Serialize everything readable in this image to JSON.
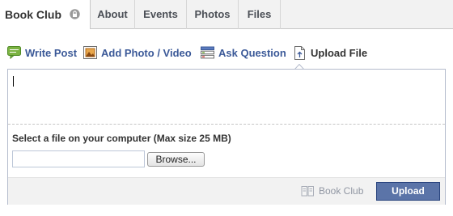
{
  "group": {
    "name": "Book Club"
  },
  "tabs": [
    {
      "label": "About"
    },
    {
      "label": "Events"
    },
    {
      "label": "Photos"
    },
    {
      "label": "Files"
    }
  ],
  "composer": {
    "tabs": [
      {
        "label": "Write Post",
        "icon": "speech-bubble-icon"
      },
      {
        "label": "Add Photo / Video",
        "icon": "photo-icon"
      },
      {
        "label": "Ask Question",
        "icon": "question-list-icon"
      },
      {
        "label": "Upload File",
        "icon": "file-upload-icon",
        "selected": true
      }
    ],
    "text_value": "",
    "file_prompt": "Select a file on your computer (Max size 25 MB)",
    "file_input_value": "",
    "browse_label": "Browse...",
    "audience_label": "Book Club",
    "upload_label": "Upload"
  },
  "colors": {
    "link_blue": "#3b5998",
    "button_blue": "#5b74a8"
  }
}
